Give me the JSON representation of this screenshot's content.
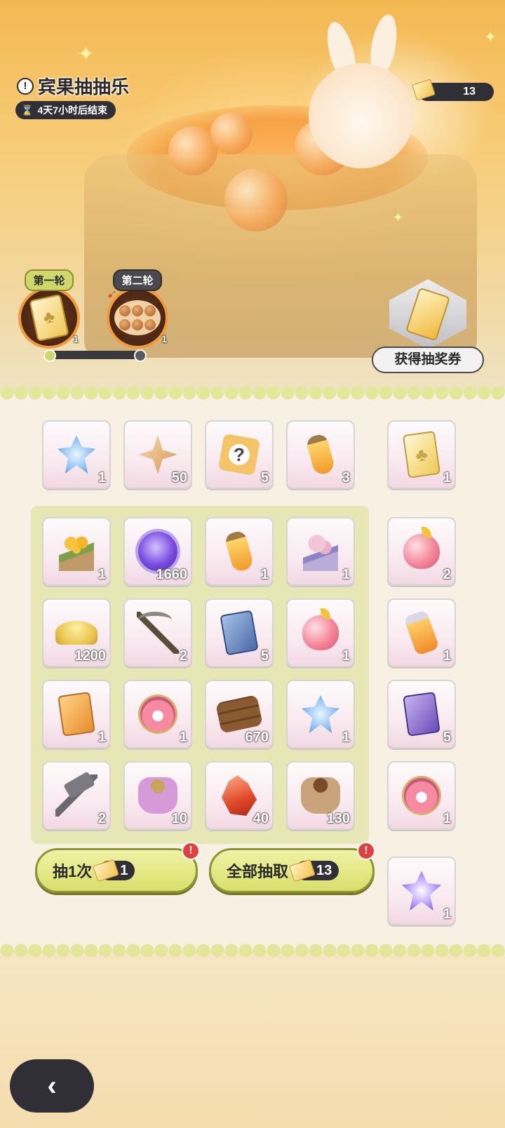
{
  "event": {
    "title": "宾果抽抽乐",
    "timer": "4天7小时后结束",
    "ticket_count": "13"
  },
  "rounds": [
    {
      "label": "第一轮",
      "count": "1",
      "state": "active"
    },
    {
      "label": "第二轮",
      "count": "1",
      "state": "locked"
    }
  ],
  "get_tickets_label": "获得抽奖券",
  "top_row": [
    {
      "icon": "blue-crystal-icon",
      "count": "1"
    },
    {
      "icon": "star-shard-icon",
      "count": "50"
    },
    {
      "icon": "mystery-box-icon",
      "count": "5"
    },
    {
      "icon": "potion-bottle-icon",
      "count": "3"
    }
  ],
  "top_row_bonus": {
    "icon": "clover-ticket-icon",
    "count": "1"
  },
  "grid": [
    [
      {
        "icon": "yellow-bouquet-icon",
        "count": "1"
      },
      {
        "icon": "purple-orb-icon",
        "count": "1660"
      },
      {
        "icon": "potion-bottle-icon",
        "count": "1"
      },
      {
        "icon": "pink-bouquet-icon",
        "count": "1"
      }
    ],
    [
      {
        "icon": "gold-sand-icon",
        "count": "1200"
      },
      {
        "icon": "pickaxe-icon",
        "count": "2"
      },
      {
        "icon": "blue-card-icon",
        "count": "5"
      },
      {
        "icon": "apple-icon",
        "count": "1"
      }
    ],
    [
      {
        "icon": "orange-card-icon",
        "count": "1"
      },
      {
        "icon": "paw-bell-icon",
        "count": "1"
      },
      {
        "icon": "wood-logs-icon",
        "count": "670"
      },
      {
        "icon": "blue-crystal-icon",
        "count": "1"
      }
    ],
    [
      {
        "icon": "hammer-icon",
        "count": "2"
      },
      {
        "icon": "purple-paw-bag-icon",
        "count": "10"
      },
      {
        "icon": "red-shard-icon",
        "count": "40"
      },
      {
        "icon": "brown-paw-bag-icon",
        "count": "130"
      }
    ]
  ],
  "side_column": [
    {
      "icon": "apple-icon",
      "count": "2"
    },
    {
      "icon": "vial-icon",
      "count": "1"
    },
    {
      "icon": "purple-card-icon",
      "count": "5"
    },
    {
      "icon": "paw-bell-icon",
      "count": "1"
    },
    {
      "icon": "purple-crystal-icon",
      "count": "1"
    }
  ],
  "buttons": {
    "draw_once_label": "抽1次",
    "draw_once_cost": "1",
    "draw_all_label": "全部抽取",
    "draw_all_cost": "13",
    "alert": "!",
    "back": "‹"
  }
}
